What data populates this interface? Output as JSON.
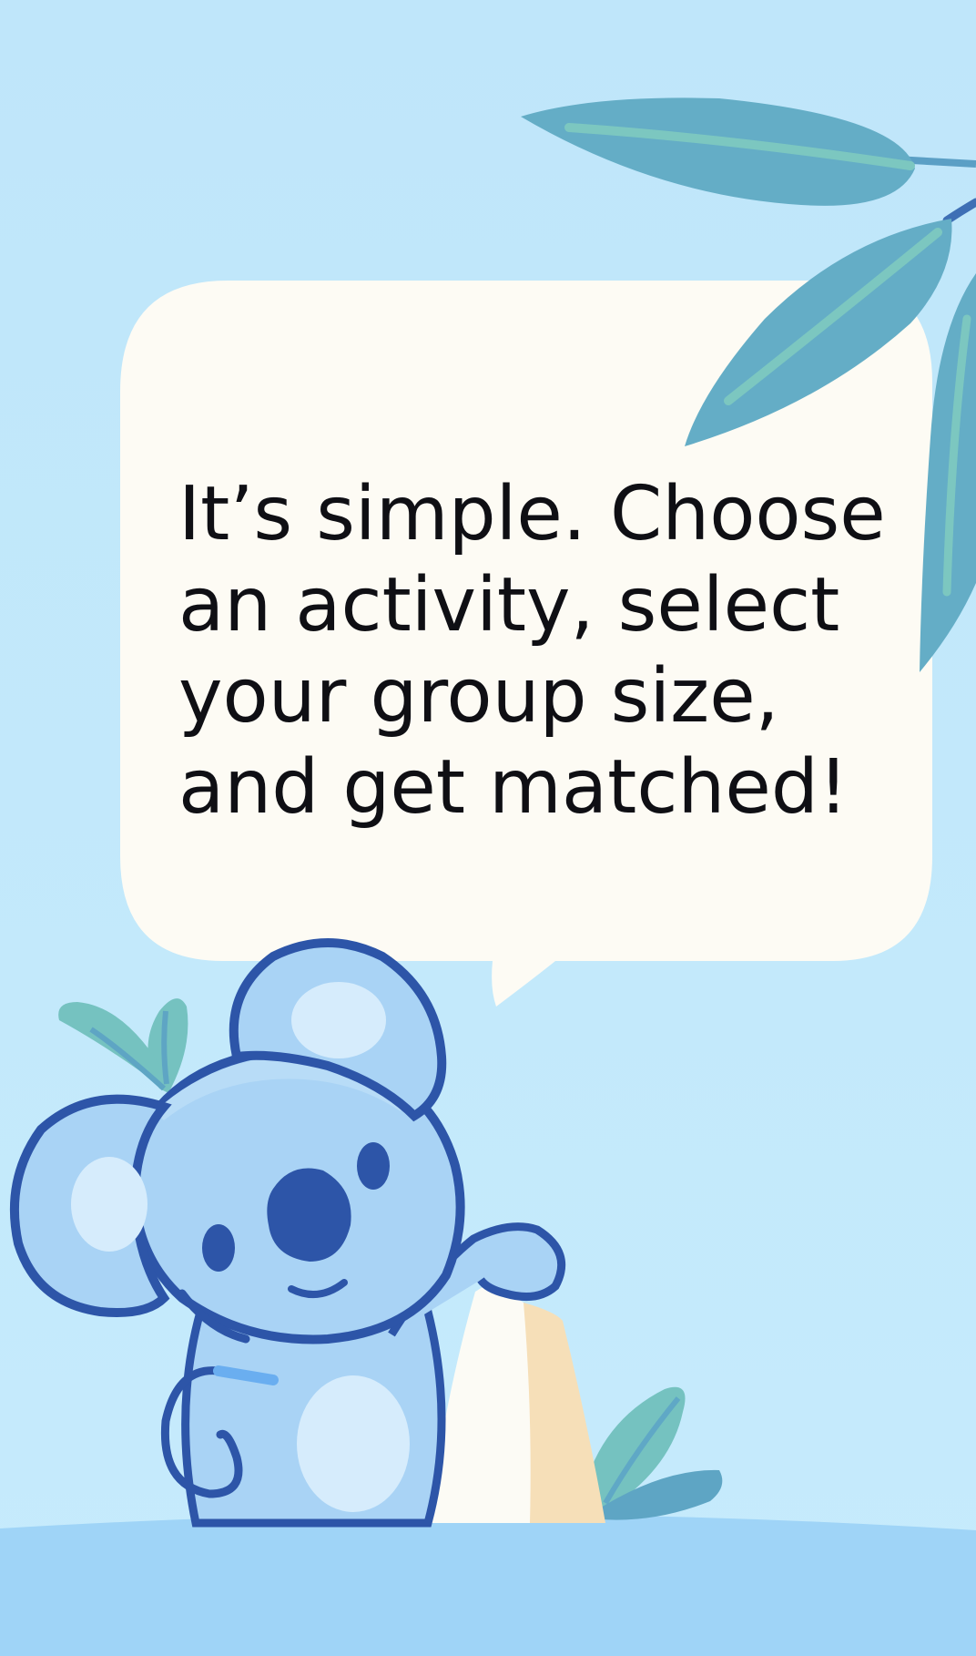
{
  "message": {
    "lines": [
      "It’s simple. Choose",
      "an activity, select",
      "your group size,",
      "and get matched!"
    ]
  },
  "illustration": {
    "character": "koala-mascot",
    "decor": [
      "eucalyptus-leaves-icon",
      "speech-bubble",
      "koala-icon"
    ]
  },
  "colors": {
    "background": "#c0e7fb",
    "bubble": "#fdfbf4",
    "leaf": "#63adc7",
    "leaf_light": "#7ec8c2",
    "koala_body": "#a9d3f5",
    "koala_outline": "#2d55a8",
    "ground": "#9fd4f7"
  }
}
